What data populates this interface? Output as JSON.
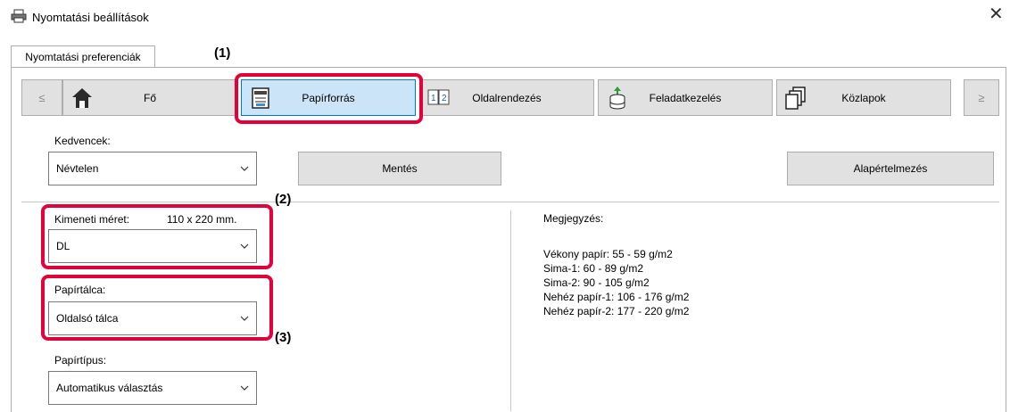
{
  "window": {
    "title": "Nyomtatási beállítások",
    "close_glyph": "✕"
  },
  "tabs": [
    {
      "label": "Nyomtatási preferenciák"
    }
  ],
  "nav": {
    "prev": "≤",
    "next": "≥",
    "items": [
      {
        "label": "Fő",
        "icon": "home-icon"
      },
      {
        "label": "Papírforrás",
        "icon": "printer-tray-icon",
        "selected": true
      },
      {
        "label": "Oldalrendezés",
        "icon": "page-layout-icon"
      },
      {
        "label": "Feladatkezelés",
        "icon": "job-handling-icon"
      },
      {
        "label": "Közlapok",
        "icon": "insert-pages-icon"
      }
    ]
  },
  "favorites": {
    "label": "Kedvencek:",
    "value": "Névtelen",
    "save_button": "Mentés",
    "default_button": "Alapértelmezés"
  },
  "output_size": {
    "label": "Kimeneti méret:",
    "size_text": "110 x 220 mm.",
    "value": "DL"
  },
  "paper_tray": {
    "label": "Papírtálca:",
    "value": "Oldalsó tálca"
  },
  "paper_type": {
    "label": "Papírtípus:",
    "value": "Automatikus választás"
  },
  "notes": {
    "title": "Megjegyzés:",
    "lines": [
      "Vékony papír: 55 - 59 g/m2",
      "Sima-1: 60 - 89 g/m2",
      "Sima-2: 90 - 105 g/m2",
      "Nehéz papír-1: 106 - 176 g/m2",
      "Nehéz papír-2: 177 - 220 g/m2"
    ]
  },
  "callouts": {
    "c1": "(1)",
    "c2": "(2)",
    "c3": "(3)"
  },
  "colors": {
    "highlight": "#e4003a",
    "selected_bg": "#cce4f7",
    "button_bg": "#e1e1e1"
  }
}
